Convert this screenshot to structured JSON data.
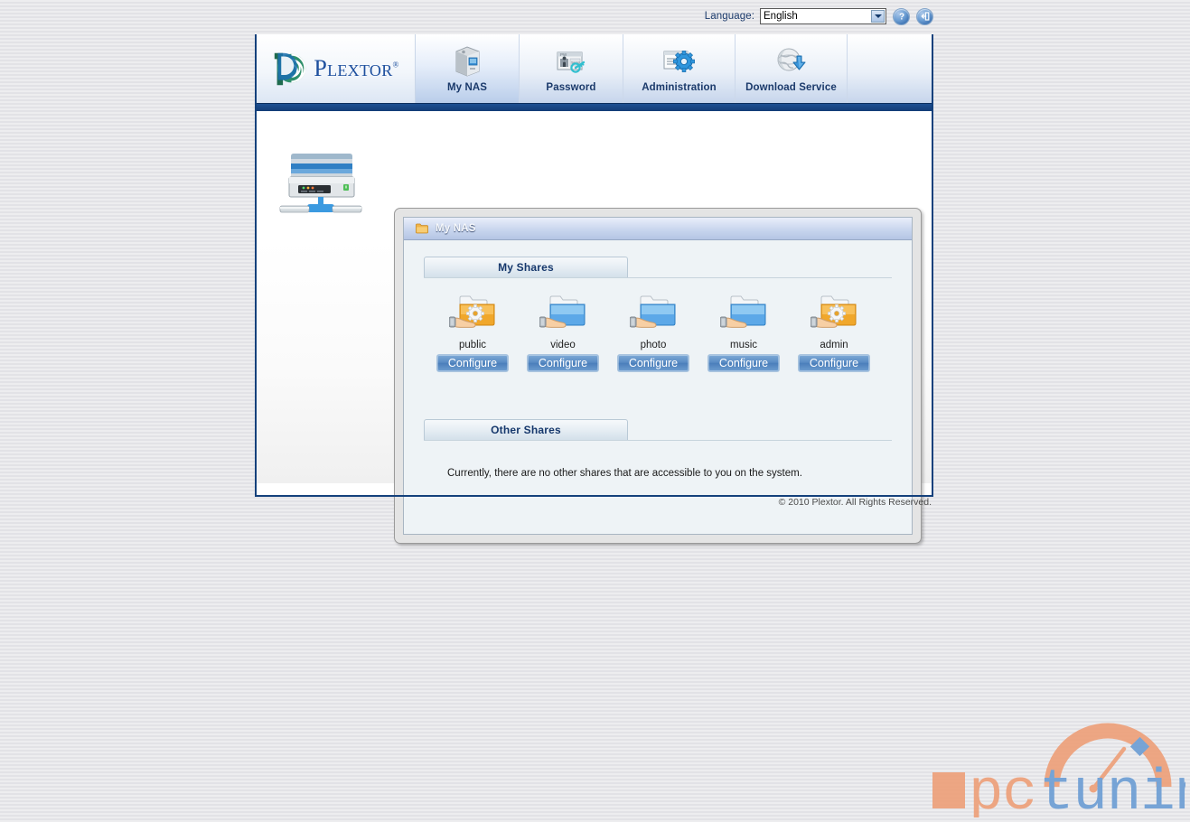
{
  "topbar": {
    "language_label": "Language:",
    "language_value": "English",
    "language_options": [
      "English"
    ],
    "help_icon": "help-circle-icon",
    "logout_icon": "logout-icon"
  },
  "header": {
    "brand": "Plextor",
    "brand_mark": "plextor-spiral-logo",
    "nav": [
      {
        "label": "My NAS",
        "icon": "nas-server-icon",
        "active": true
      },
      {
        "label": "Password",
        "icon": "password-key-icon",
        "active": false
      },
      {
        "label": "Administration",
        "icon": "administration-gear-icon",
        "active": false
      },
      {
        "label": "Download Service",
        "icon": "download-globe-icon",
        "active": false
      }
    ]
  },
  "content": {
    "device_illustration": "nas-device-illustration",
    "panel": {
      "title": "My NAS",
      "title_icon": "folder-icon",
      "sections": [
        {
          "key": "my_shares",
          "title": "My Shares"
        },
        {
          "key": "other_shares",
          "title": "Other Shares"
        }
      ],
      "shares": [
        {
          "name": "public",
          "icon": "shared-folder-config-icon",
          "folder_color": "#f0a72b",
          "button": "Configure"
        },
        {
          "name": "video",
          "icon": "shared-folder-icon",
          "folder_color": "#5ca8e8",
          "button": "Configure"
        },
        {
          "name": "photo",
          "icon": "shared-folder-icon",
          "folder_color": "#5ca8e8",
          "button": "Configure"
        },
        {
          "name": "music",
          "icon": "shared-folder-icon",
          "folder_color": "#5ca8e8",
          "button": "Configure"
        },
        {
          "name": "admin",
          "icon": "shared-folder-config-icon",
          "folder_color": "#f0a72b",
          "button": "Configure"
        }
      ],
      "other_shares_message": "Currently, there are no other shares that are accessible to you on the system."
    }
  },
  "footer": {
    "copyright": "© 2010 Plextor. All Rights Reserved."
  },
  "watermark": {
    "text_pc": "pc",
    "text_tuning": "tuning",
    "color_orange": "#eda07a",
    "color_blue": "#6d9ed4"
  }
}
